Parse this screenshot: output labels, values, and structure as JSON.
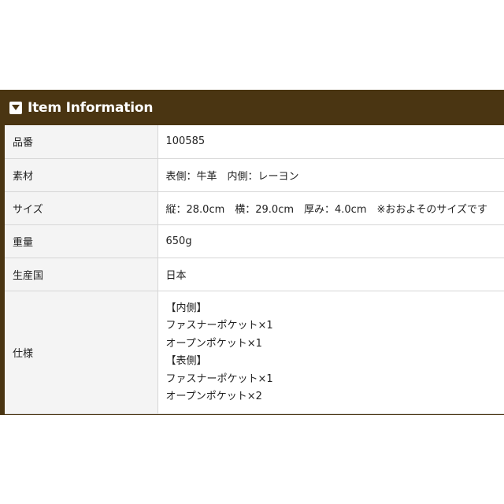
{
  "panel": {
    "title": "Item Information",
    "header_color": "#4a3512",
    "icon": "chevron-down-icon"
  },
  "rows": [
    {
      "label": "品番",
      "value": "100585"
    },
    {
      "label": "素材",
      "value": "表側：牛革　内側：レーヨン"
    },
    {
      "label": "サイズ",
      "value": "縦：28.0cm　横：29.0cm　厚み：4.0cm　※おおよそのサイズです"
    },
    {
      "label": "重量",
      "value": "650g"
    },
    {
      "label": "生産国",
      "value": "日本"
    },
    {
      "label": "仕様",
      "lines": [
        "【内側】",
        "ファスナーポケット×1",
        "オープンポケット×1",
        "【表側】",
        "ファスナーポケット×1",
        "オープンポケット×2"
      ]
    }
  ]
}
